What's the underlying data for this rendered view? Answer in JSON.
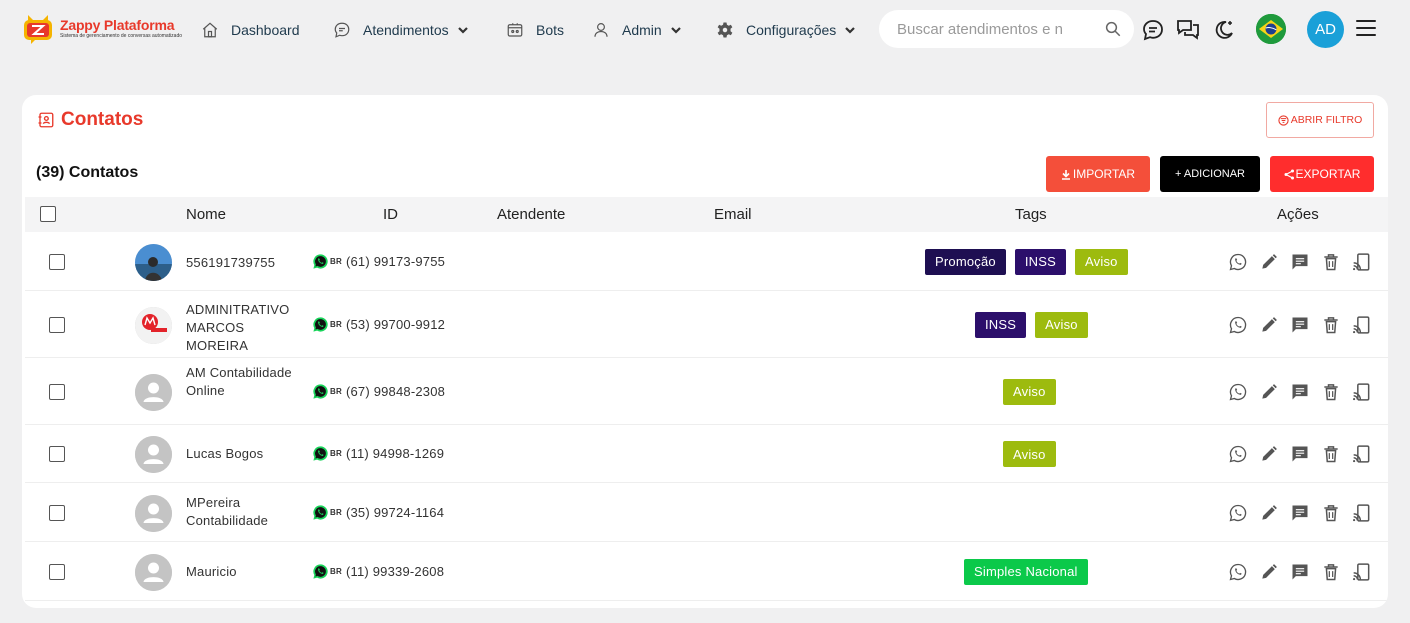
{
  "brand": {
    "title": "Zappy Plataforma",
    "subtitle": "Sistema de gerenciamento de conversas automatizado"
  },
  "nav": [
    {
      "label": "Dashboard",
      "icon": "home-icon"
    },
    {
      "label": "Atendimentos",
      "icon": "chat-icon",
      "dropdown": true
    },
    {
      "label": "Bots",
      "icon": "bot-icon"
    },
    {
      "label": "Admin",
      "icon": "user-icon",
      "dropdown": true
    },
    {
      "label": "Configurações",
      "icon": "gear-icon",
      "dropdown": true
    }
  ],
  "search": {
    "placeholder": "Buscar atendimentos e n",
    "value": ""
  },
  "user": {
    "initials": "AD",
    "avatar_color": "#1aa0d8"
  },
  "colors": {
    "accent": "#e8392b",
    "import": "#f44f3a",
    "export": "#ff2d2d"
  },
  "page": {
    "title": "Contatos",
    "filter_label": "ABRIR FILTRO",
    "count_label": "(39) Contatos",
    "import_label": "IMPORTAR",
    "add_label": "+ ADICIONAR",
    "export_label": "EXPORTAR"
  },
  "table": {
    "columns": [
      "Nome",
      "ID",
      "Atendente",
      "Email",
      "Tags",
      "Ações"
    ],
    "rows": [
      {
        "name": "556191739755",
        "country": "BR",
        "phone": "(61) 99173-9755",
        "atendente": "",
        "email": "",
        "avatar": "photo",
        "tags": [
          {
            "label": "Promoção",
            "color": "#1e0f52"
          },
          {
            "label": "INSS",
            "color": "#2c0f6b"
          },
          {
            "label": "Aviso",
            "color": "#9dbb0e"
          }
        ]
      },
      {
        "name": "ADMINITRATIVO MARCOS MOREIRA",
        "country": "BR",
        "phone": "(53) 99700-9912",
        "atendente": "",
        "email": "",
        "avatar": "logo",
        "tags": [
          {
            "label": "INSS",
            "color": "#2c0f6b"
          },
          {
            "label": "Aviso",
            "color": "#9dbb0e"
          }
        ]
      },
      {
        "name": "AM Contabilidade Online",
        "country": "BR",
        "phone": "(67) 99848-2308",
        "atendente": "",
        "email": "",
        "avatar": "default",
        "tags": [
          {
            "label": "Aviso",
            "color": "#9dbb0e"
          }
        ]
      },
      {
        "name": "Lucas Bogos",
        "country": "BR",
        "phone": "(11) 94998-1269",
        "atendente": "",
        "email": "",
        "avatar": "default",
        "tags": [
          {
            "label": "Aviso",
            "color": "#9dbb0e"
          }
        ]
      },
      {
        "name": "MPereira Contabilidade",
        "country": "BR",
        "phone": "(35) 99724-1164",
        "atendente": "",
        "email": "",
        "avatar": "default",
        "tags": []
      },
      {
        "name": "Mauricio",
        "country": "BR",
        "phone": "(11) 99339-2608",
        "atendente": "",
        "email": "",
        "avatar": "default",
        "tags": [
          {
            "label": "Simples Nacional",
            "color": "#0bc94a"
          }
        ]
      }
    ],
    "actions": [
      "whatsapp-icon",
      "edit-icon",
      "message-icon",
      "trash-icon",
      "cast-icon"
    ]
  }
}
